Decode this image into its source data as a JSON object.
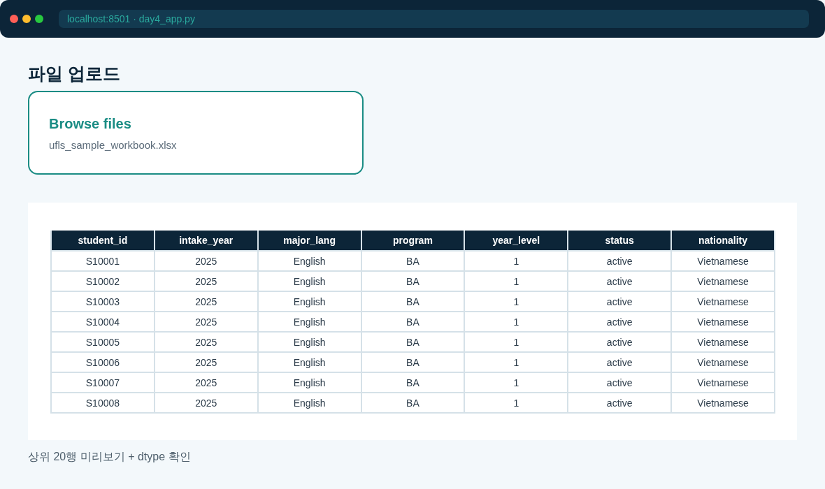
{
  "window": {
    "address": "localhost:8501 · day4_app.py"
  },
  "page_title": "파일 업로드",
  "uploader": {
    "button": "Browse files",
    "file_name": "ufls_sample_workbook.xlsx"
  },
  "table": {
    "columns": [
      "student_id",
      "intake_year",
      "major_lang",
      "program",
      "year_level",
      "status",
      "nationality"
    ],
    "rows": [
      [
        "S10001",
        "2025",
        "English",
        "BA",
        "1",
        "active",
        "Vietnamese"
      ],
      [
        "S10002",
        "2025",
        "English",
        "BA",
        "1",
        "active",
        "Vietnamese"
      ],
      [
        "S10003",
        "2025",
        "English",
        "BA",
        "1",
        "active",
        "Vietnamese"
      ],
      [
        "S10004",
        "2025",
        "English",
        "BA",
        "1",
        "active",
        "Vietnamese"
      ],
      [
        "S10005",
        "2025",
        "English",
        "BA",
        "1",
        "active",
        "Vietnamese"
      ],
      [
        "S10006",
        "2025",
        "English",
        "BA",
        "1",
        "active",
        "Vietnamese"
      ],
      [
        "S10007",
        "2025",
        "English",
        "BA",
        "1",
        "active",
        "Vietnamese"
      ],
      [
        "S10008",
        "2025",
        "English",
        "BA",
        "1",
        "active",
        "Vietnamese"
      ]
    ]
  },
  "caption": "상위 20행 미리보기 + dtype 확인"
}
